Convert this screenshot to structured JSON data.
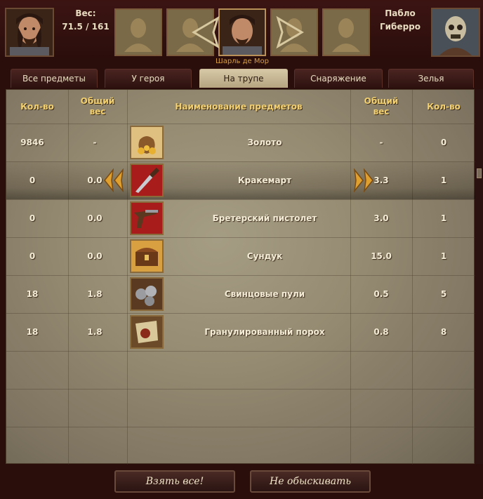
{
  "header": {
    "weight_label": "Вес:",
    "weight_value": "71.5 / 161",
    "hero_caption": "Шарль де Мор",
    "enemy_first": "Пабло",
    "enemy_last": "Гиберро"
  },
  "tabs": [
    {
      "label": "Все предметы"
    },
    {
      "label": "У героя"
    },
    {
      "label": "На трупе"
    },
    {
      "label": "Снаряжение"
    },
    {
      "label": "Зелья"
    }
  ],
  "active_tab": "На трупе",
  "columns": {
    "left_qty": "Кол-во",
    "left_weight_1": "Общий",
    "left_weight_2": "вес",
    "name": "Наименование предметов",
    "right_weight_1": "Общий",
    "right_weight_2": "вес",
    "right_qty": "Кол-во"
  },
  "items": [
    {
      "hero_qty": "9846",
      "hero_weight": "-",
      "name": "Золото",
      "corpse_weight": "-",
      "corpse_qty": "0",
      "icon": "gold-pouch-icon"
    },
    {
      "hero_qty": "0",
      "hero_weight": "0.0",
      "name": "Кракемарт",
      "corpse_weight": "3.3",
      "corpse_qty": "1",
      "icon": "dagger-icon"
    },
    {
      "hero_qty": "0",
      "hero_weight": "0.0",
      "name": "Бретерский пистолет",
      "corpse_weight": "3.0",
      "corpse_qty": "1",
      "icon": "pistol-icon"
    },
    {
      "hero_qty": "0",
      "hero_weight": "0.0",
      "name": "Сундук",
      "corpse_weight": "15.0",
      "corpse_qty": "1",
      "icon": "chest-icon"
    },
    {
      "hero_qty": "18",
      "hero_weight": "1.8",
      "name": "Свинцовые пули",
      "corpse_weight": "0.5",
      "corpse_qty": "5",
      "icon": "bullets-icon"
    },
    {
      "hero_qty": "18",
      "hero_weight": "1.8",
      "name": "Гранулированный порох",
      "corpse_weight": "0.8",
      "corpse_qty": "8",
      "icon": "gunpowder-icon"
    }
  ],
  "selected_row": "Кракемарт",
  "buttons": {
    "take_all": "Взять все!",
    "dont_search": "Не обыскивать"
  },
  "colors": {
    "header_text": "#f2d070",
    "caption": "#d8a040",
    "frame": "#2a0e0c"
  }
}
